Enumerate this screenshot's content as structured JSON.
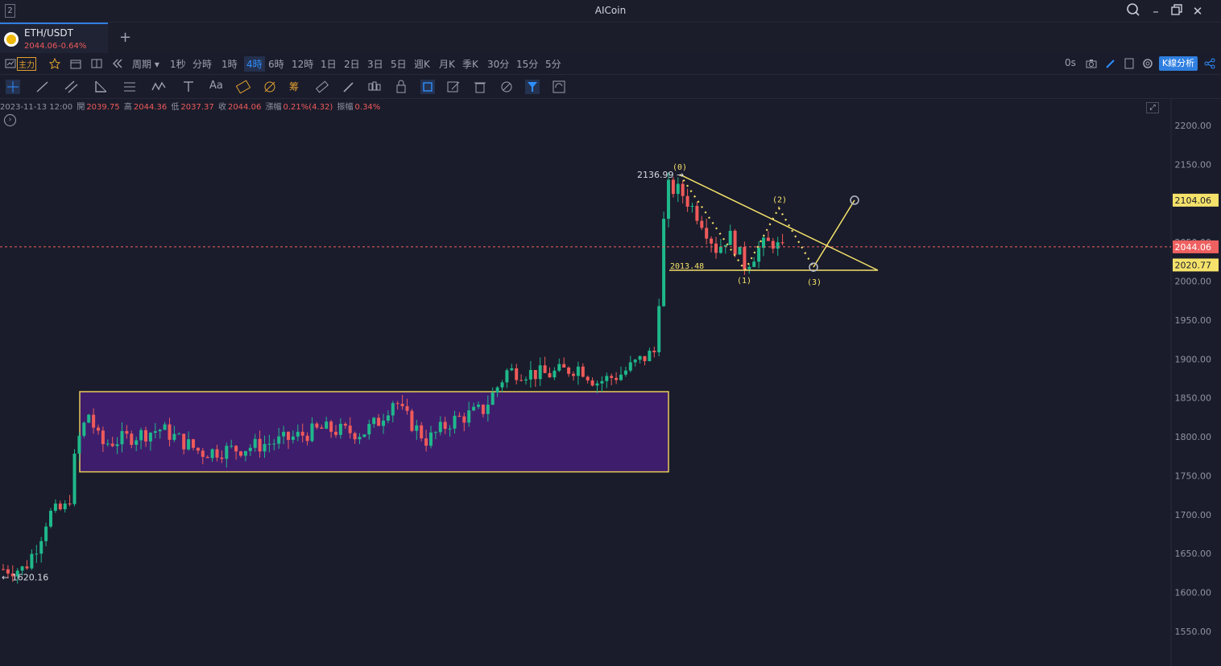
{
  "window": {
    "title": "AICoin",
    "badge": "2"
  },
  "tab": {
    "symbol": "ETH/USDT",
    "price": "2044.06",
    "change": "-0.64%"
  },
  "periodbar": {
    "main_label": "主力",
    "period_label": "周期",
    "periods": [
      "1秒",
      "分時",
      "1時",
      "4時",
      "6時",
      "12時",
      "1日",
      "2日",
      "3日",
      "5日",
      "週K",
      "月K",
      "季K",
      "30分",
      "15分",
      "5分"
    ],
    "active_period": "4時",
    "countdown": "0s",
    "kline_analysis": "K線分析"
  },
  "ohlc": {
    "datetime": "2023-11-13 12:00",
    "open_label": "開",
    "open": "2039.75",
    "high_label": "高",
    "high": "2044.36",
    "low_label": "低",
    "low": "2037.37",
    "close_label": "收",
    "close": "2044.06",
    "change_label": "漲幅",
    "change": "0.21%(4.32)",
    "amp_label": "振幅",
    "amp": "0.34%"
  },
  "chart_data": {
    "type": "candlestick",
    "y_axis_ticks": [
      "2200.00",
      "2150.00",
      "2100.00",
      "2050.00",
      "2000.00",
      "1950.00",
      "1900.00",
      "1850.00",
      "1800.00",
      "1750.00",
      "1700.00",
      "1650.00",
      "1600.00",
      "1550.00"
    ],
    "ylim": [
      1520,
      2230
    ],
    "price_labels": [
      {
        "text": "2104.06",
        "value": 2104.06,
        "color": "#f5e26a"
      },
      {
        "text": "2044.06",
        "value": 2044.06,
        "color": "#ef6060"
      },
      {
        "text": "2020.77",
        "value": 2020.77,
        "color": "#f5e26a"
      }
    ],
    "annotations": {
      "high_mark": "2136.99",
      "low_mark": "1620.16",
      "level_mark": "2013.48",
      "wave_labels": [
        "(0)",
        "(1)",
        "(2)",
        "(3)"
      ]
    },
    "current_price": 2044.06,
    "range_box": {
      "low": 1755,
      "high": 1858
    }
  },
  "colors": {
    "up": "#1fb88b",
    "down": "#ef5a5a",
    "accent": "#2f7fe0",
    "drawing": "#f5e26a",
    "box_fill": "#3e1e6c"
  }
}
